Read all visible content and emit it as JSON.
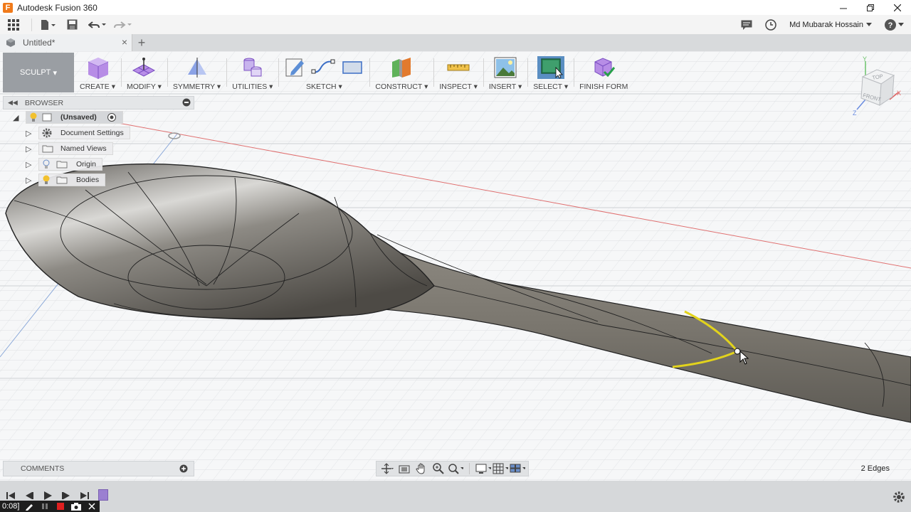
{
  "window": {
    "app_logo_letter": "F",
    "title": "Autodesk Fusion 360"
  },
  "quick_access": {
    "user_name": "Md Mubarak Hossain"
  },
  "tabs": [
    {
      "label": "Untitled*"
    }
  ],
  "toolbar": {
    "workspace": "SCULPT",
    "groups": [
      {
        "label": "CREATE"
      },
      {
        "label": "MODIFY"
      },
      {
        "label": "SYMMETRY"
      },
      {
        "label": "UTILITIES"
      },
      {
        "label": "SKETCH"
      },
      {
        "label": "CONSTRUCT"
      },
      {
        "label": "INSPECT"
      },
      {
        "label": "INSERT"
      },
      {
        "label": "SELECT"
      },
      {
        "label": "FINISH FORM"
      }
    ],
    "dropdown_arrow": "▾"
  },
  "browser": {
    "header": "BROWSER",
    "root": "(Unsaved)",
    "items": [
      {
        "label": "Document Settings"
      },
      {
        "label": "Named Views"
      },
      {
        "label": "Origin"
      },
      {
        "label": "Bodies"
      }
    ]
  },
  "comments": {
    "header": "COMMENTS"
  },
  "viewcube": {
    "top": "TOP",
    "front": "FRONT",
    "axis_x": "X",
    "axis_y": "Y",
    "axis_z": "Z"
  },
  "status": {
    "selection": "2 Edges"
  },
  "recorder": {
    "time": "0:08]"
  },
  "colors": {
    "accent_select": "#5a8ec2",
    "edge_highlight": "#e6d41e",
    "red_axis": "#e05050",
    "body_fill": "#7b776f",
    "workspace_bg": "#9a9ea3"
  },
  "icons": [
    "grid-icon",
    "file-icon",
    "save-icon",
    "undo-icon",
    "redo-icon",
    "comment-icon",
    "clock-icon",
    "help-icon",
    "close-icon",
    "minimize-icon",
    "maximize-icon"
  ]
}
